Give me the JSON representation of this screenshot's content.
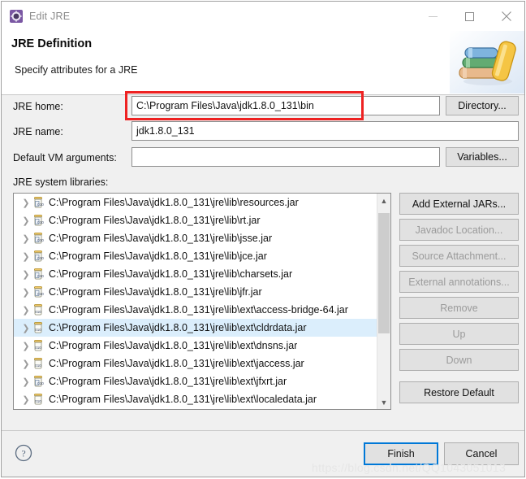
{
  "window": {
    "title": "Edit JRE",
    "icon": "jre-gear-icon",
    "controls": {
      "minimize": "minimize-icon",
      "maximize": "maximize-icon",
      "close": "close-icon"
    }
  },
  "header": {
    "title": "JRE Definition",
    "subtitle": "Specify attributes for a JRE",
    "art": "books-stack-image"
  },
  "form": {
    "jre_home": {
      "label": "JRE home:",
      "value": "C:\\Program Files\\Java\\jdk1.8.0_131\\bin",
      "placeholder": "",
      "button": "Directory...",
      "highlighted": true,
      "highlight_color": "#ee2222"
    },
    "jre_name": {
      "label": "JRE name:",
      "value": "jdk1.8.0_131",
      "placeholder": ""
    },
    "vm_args": {
      "label": "Default VM arguments:",
      "value": "",
      "placeholder": "",
      "button": "Variables..."
    },
    "libraries_label": "JRE system libraries:"
  },
  "libraries": {
    "selection_color": "#dbeefc",
    "rows": [
      {
        "path": "C:\\Program Files\\Java\\jdk1.8.0_131\\jre\\lib\\resources.jar",
        "icon": "jar-source-icon",
        "selected": false
      },
      {
        "path": "C:\\Program Files\\Java\\jdk1.8.0_131\\jre\\lib\\rt.jar",
        "icon": "jar-source-icon",
        "selected": false
      },
      {
        "path": "C:\\Program Files\\Java\\jdk1.8.0_131\\jre\\lib\\jsse.jar",
        "icon": "jar-source-icon",
        "selected": false
      },
      {
        "path": "C:\\Program Files\\Java\\jdk1.8.0_131\\jre\\lib\\jce.jar",
        "icon": "jar-source-icon",
        "selected": false
      },
      {
        "path": "C:\\Program Files\\Java\\jdk1.8.0_131\\jre\\lib\\charsets.jar",
        "icon": "jar-source-icon",
        "selected": false
      },
      {
        "path": "C:\\Program Files\\Java\\jdk1.8.0_131\\jre\\lib\\jfr.jar",
        "icon": "jar-source-icon",
        "selected": false
      },
      {
        "path": "C:\\Program Files\\Java\\jdk1.8.0_131\\jre\\lib\\ext\\access-bridge-64.jar",
        "icon": "jar-icon",
        "selected": false
      },
      {
        "path": "C:\\Program Files\\Java\\jdk1.8.0_131\\jre\\lib\\ext\\cldrdata.jar",
        "icon": "jar-icon",
        "selected": true
      },
      {
        "path": "C:\\Program Files\\Java\\jdk1.8.0_131\\jre\\lib\\ext\\dnsns.jar",
        "icon": "jar-icon",
        "selected": false
      },
      {
        "path": "C:\\Program Files\\Java\\jdk1.8.0_131\\jre\\lib\\ext\\jaccess.jar",
        "icon": "jar-icon",
        "selected": false
      },
      {
        "path": "C:\\Program Files\\Java\\jdk1.8.0_131\\jre\\lib\\ext\\jfxrt.jar",
        "icon": "jar-source-icon",
        "selected": false
      },
      {
        "path": "C:\\Program Files\\Java\\jdk1.8.0_131\\jre\\lib\\ext\\localedata.jar",
        "icon": "jar-icon",
        "selected": false
      }
    ]
  },
  "side_buttons": [
    {
      "label": "Add External JARs...",
      "enabled": true
    },
    {
      "label": "Javadoc Location...",
      "enabled": false
    },
    {
      "label": "Source Attachment...",
      "enabled": false
    },
    {
      "label": "External annotations...",
      "enabled": false
    },
    {
      "label": "Remove",
      "enabled": false
    },
    {
      "label": "Up",
      "enabled": false
    },
    {
      "label": "Down",
      "enabled": false
    },
    {
      "label": "Restore Default",
      "enabled": true
    }
  ],
  "footer": {
    "help": "help-icon",
    "finish": "Finish",
    "cancel": "Cancel",
    "focus_color": "#0078d7"
  },
  "watermark": "https://blog.csdn.net/QQ1043051013"
}
